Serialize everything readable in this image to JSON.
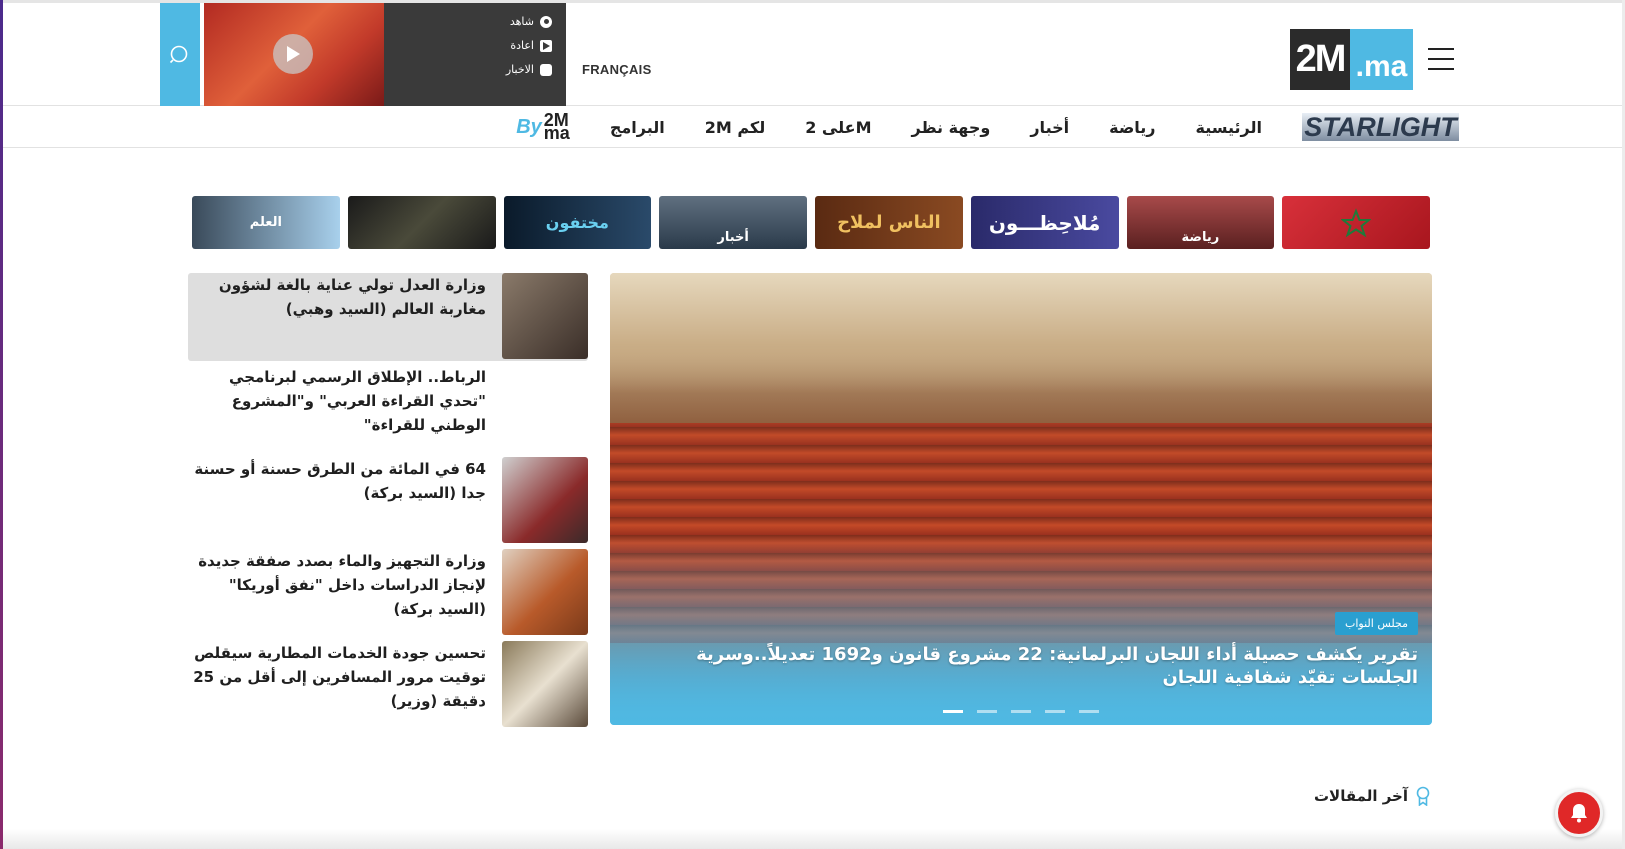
{
  "header": {
    "language_link": "FRANÇAIS",
    "logo": {
      "left": "2M",
      "right": ".ma"
    },
    "player": {
      "items": [
        {
          "label": "شاهد",
          "icon": "circle-dot-icon"
        },
        {
          "label": "اعادة",
          "icon": "play-icon"
        },
        {
          "label": "الاخبار",
          "icon": "news-icon"
        }
      ]
    }
  },
  "nav": {
    "brand": "STARLIGHT",
    "items": [
      "الرئيسية",
      "رياضة",
      "أخبار",
      "وجهة نظر",
      "على 2M",
      "2M لكم",
      "البرامج"
    ],
    "by2m": {
      "by": "By",
      "m": "2M",
      "ma": "ma"
    }
  },
  "programs": [
    {
      "name": "flag-morocco",
      "caption": "",
      "bg": "#c8232c"
    },
    {
      "name": "riyada",
      "caption": "رياضة",
      "bg": "#8b2f2f"
    },
    {
      "name": "molahidoun",
      "caption": "مُلاحِظـــون",
      "bg": "#3a3a7a"
    },
    {
      "name": "nass-lmlah",
      "caption": "الناس لملاح",
      "bg": "#6b3a1e"
    },
    {
      "name": "akhbar",
      "caption": "أخبار",
      "bg": "#445566"
    },
    {
      "name": "mokhtafoun",
      "caption": "مختفون",
      "bg": "#1a2a3a"
    },
    {
      "name": "sport-shoes",
      "caption": "",
      "bg": "#2a2a2a"
    },
    {
      "name": "al-ilm",
      "caption": "العلم",
      "bg": "#8ab8d8"
    }
  ],
  "featured": {
    "badge": "مجلس النواب",
    "title": "تقرير يكشف حصيلة أداء اللجان البرلمانية: 22 مشروع قانون و1692 تعديلاً..وسرية الجلسات تقيّد شفافية اللجان",
    "slides": 5,
    "active_slide": 1
  },
  "side_news": [
    {
      "title": "وزارة العدل تولي عناية بالغة لشؤون مغاربة العالم (السيد وهبي)",
      "thumb": "#5a4a3a",
      "highlight": true
    },
    {
      "title": "الرباط.. الإطلاق الرسمي لبرنامجي \"تحدي القراءة العربي\" و\"المشروع الوطني للقراءة\"",
      "thumb": "",
      "highlight": false
    },
    {
      "title": "64 في المائة من الطرق حسنة أو حسنة جدا (السيد بركة)",
      "thumb": "#8a3a2a",
      "highlight": false
    },
    {
      "title": "وزارة التجهيز والماء بصدد صفقة جديدة لإنجاز الدراسات داخل \"نفق أوريكا\" (السيد بركة)",
      "thumb": "#a04a2a",
      "highlight": false
    },
    {
      "title": "تحسين جودة الخدمات المطارية سيقلص توقيت مرور المسافرين إلى أقل من 25 دقيقة (وزير)",
      "thumb": "#6a5a3a",
      "highlight": false
    }
  ],
  "latest": {
    "label": "آخر المقالات"
  },
  "colors": {
    "accent": "#4fb9e3",
    "notify": "#e02828"
  }
}
